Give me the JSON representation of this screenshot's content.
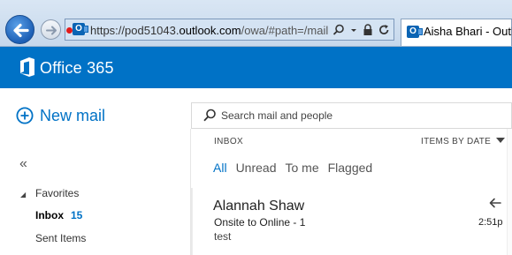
{
  "browser": {
    "url_prefix": "https://pod51043.",
    "url_domain": "outlook.com",
    "url_rest": "/owa/#path=/mail",
    "tab_title": "Aisha Bhari - Outlo"
  },
  "app": {
    "name": "Office 365"
  },
  "left_pane": {
    "new_mail_label": "New mail",
    "collapse_glyph": "«",
    "favorites_label": "Favorites",
    "inbox_label": "Inbox",
    "inbox_count": "15",
    "sent_label": "Sent Items"
  },
  "search": {
    "placeholder": "Search mail and people"
  },
  "list_header": {
    "folder": "INBOX",
    "sort_label": "ITEMS BY DATE"
  },
  "filters": [
    "All",
    "Unread",
    "To me",
    "Flagged"
  ],
  "messages": [
    {
      "sender": "Alannah Shaw",
      "subject": "Onsite to Online - 1",
      "preview": "test",
      "time": "2:51p",
      "status_icon": "reply-arrow-icon"
    }
  ],
  "colors": {
    "brand": "#0072c6",
    "chrome": "#c6d8ec"
  }
}
